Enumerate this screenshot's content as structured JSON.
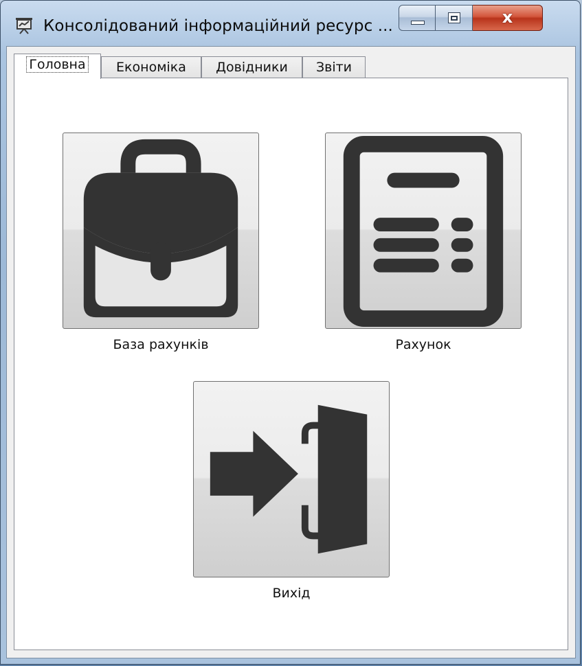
{
  "window": {
    "title": "Консолідований інформаційний ресурс ...",
    "close_glyph": "x",
    "icons": {
      "app": "presentation-chart-icon",
      "minimize": "minimize-icon",
      "maximize": "maximize-icon",
      "close": "close-icon"
    }
  },
  "tabs": [
    {
      "label": "Головна",
      "active": true
    },
    {
      "label": "Економіка",
      "active": false
    },
    {
      "label": "Довідники",
      "active": false
    },
    {
      "label": "Звіти",
      "active": false
    }
  ],
  "tiles": [
    {
      "label": "База рахунків",
      "icon": "briefcase-icon"
    },
    {
      "label": "Рахунок",
      "icon": "invoice-document-icon"
    },
    {
      "label": "Вихід",
      "icon": "exit-door-icon"
    }
  ],
  "colors": {
    "icon": "#333333",
    "close_button": "#c7432a"
  }
}
